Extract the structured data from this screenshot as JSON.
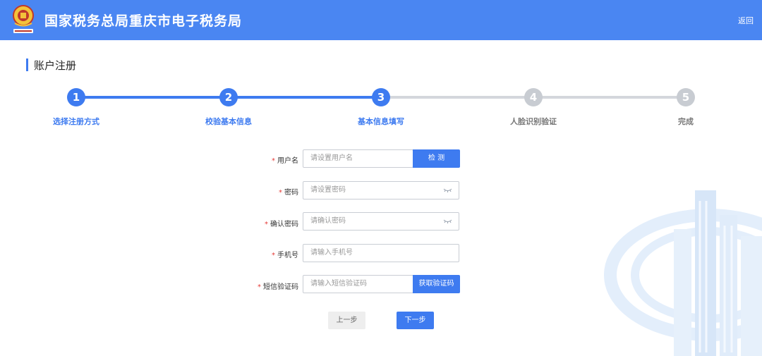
{
  "header": {
    "title": "国家税务总局重庆市电子税务局",
    "back_label": "返回",
    "bg_color": "#4a86f2"
  },
  "section": {
    "title": "账户注册"
  },
  "steps": [
    {
      "number": "1",
      "label": "选择注册方式",
      "state": "done"
    },
    {
      "number": "2",
      "label": "校验基本信息",
      "state": "done"
    },
    {
      "number": "3",
      "label": "基本信息填写",
      "state": "current"
    },
    {
      "number": "4",
      "label": "人脸识别验证",
      "state": "pending"
    },
    {
      "number": "5",
      "label": "完成",
      "state": "pending"
    }
  ],
  "form": {
    "required_mark": "*",
    "username": {
      "label": "用户名",
      "placeholder": "请设置用户名",
      "button": "检 测"
    },
    "password": {
      "label": "密码",
      "placeholder": "请设置密码",
      "icon": "eye-closed-icon"
    },
    "confirm_password": {
      "label": "确认密码",
      "placeholder": "请确认密码",
      "icon": "eye-closed-icon"
    },
    "phone": {
      "label": "手机号",
      "placeholder": "请输入手机号"
    },
    "sms_code": {
      "label": "短信验证码",
      "placeholder": "请输入短信验证码",
      "button": "获取验证码"
    }
  },
  "actions": {
    "prev_label": "上一步",
    "next_label": "下一步"
  },
  "colors": {
    "primary": "#3e7bf0",
    "inactive": "#c8ccd2",
    "required": "#e53935"
  }
}
